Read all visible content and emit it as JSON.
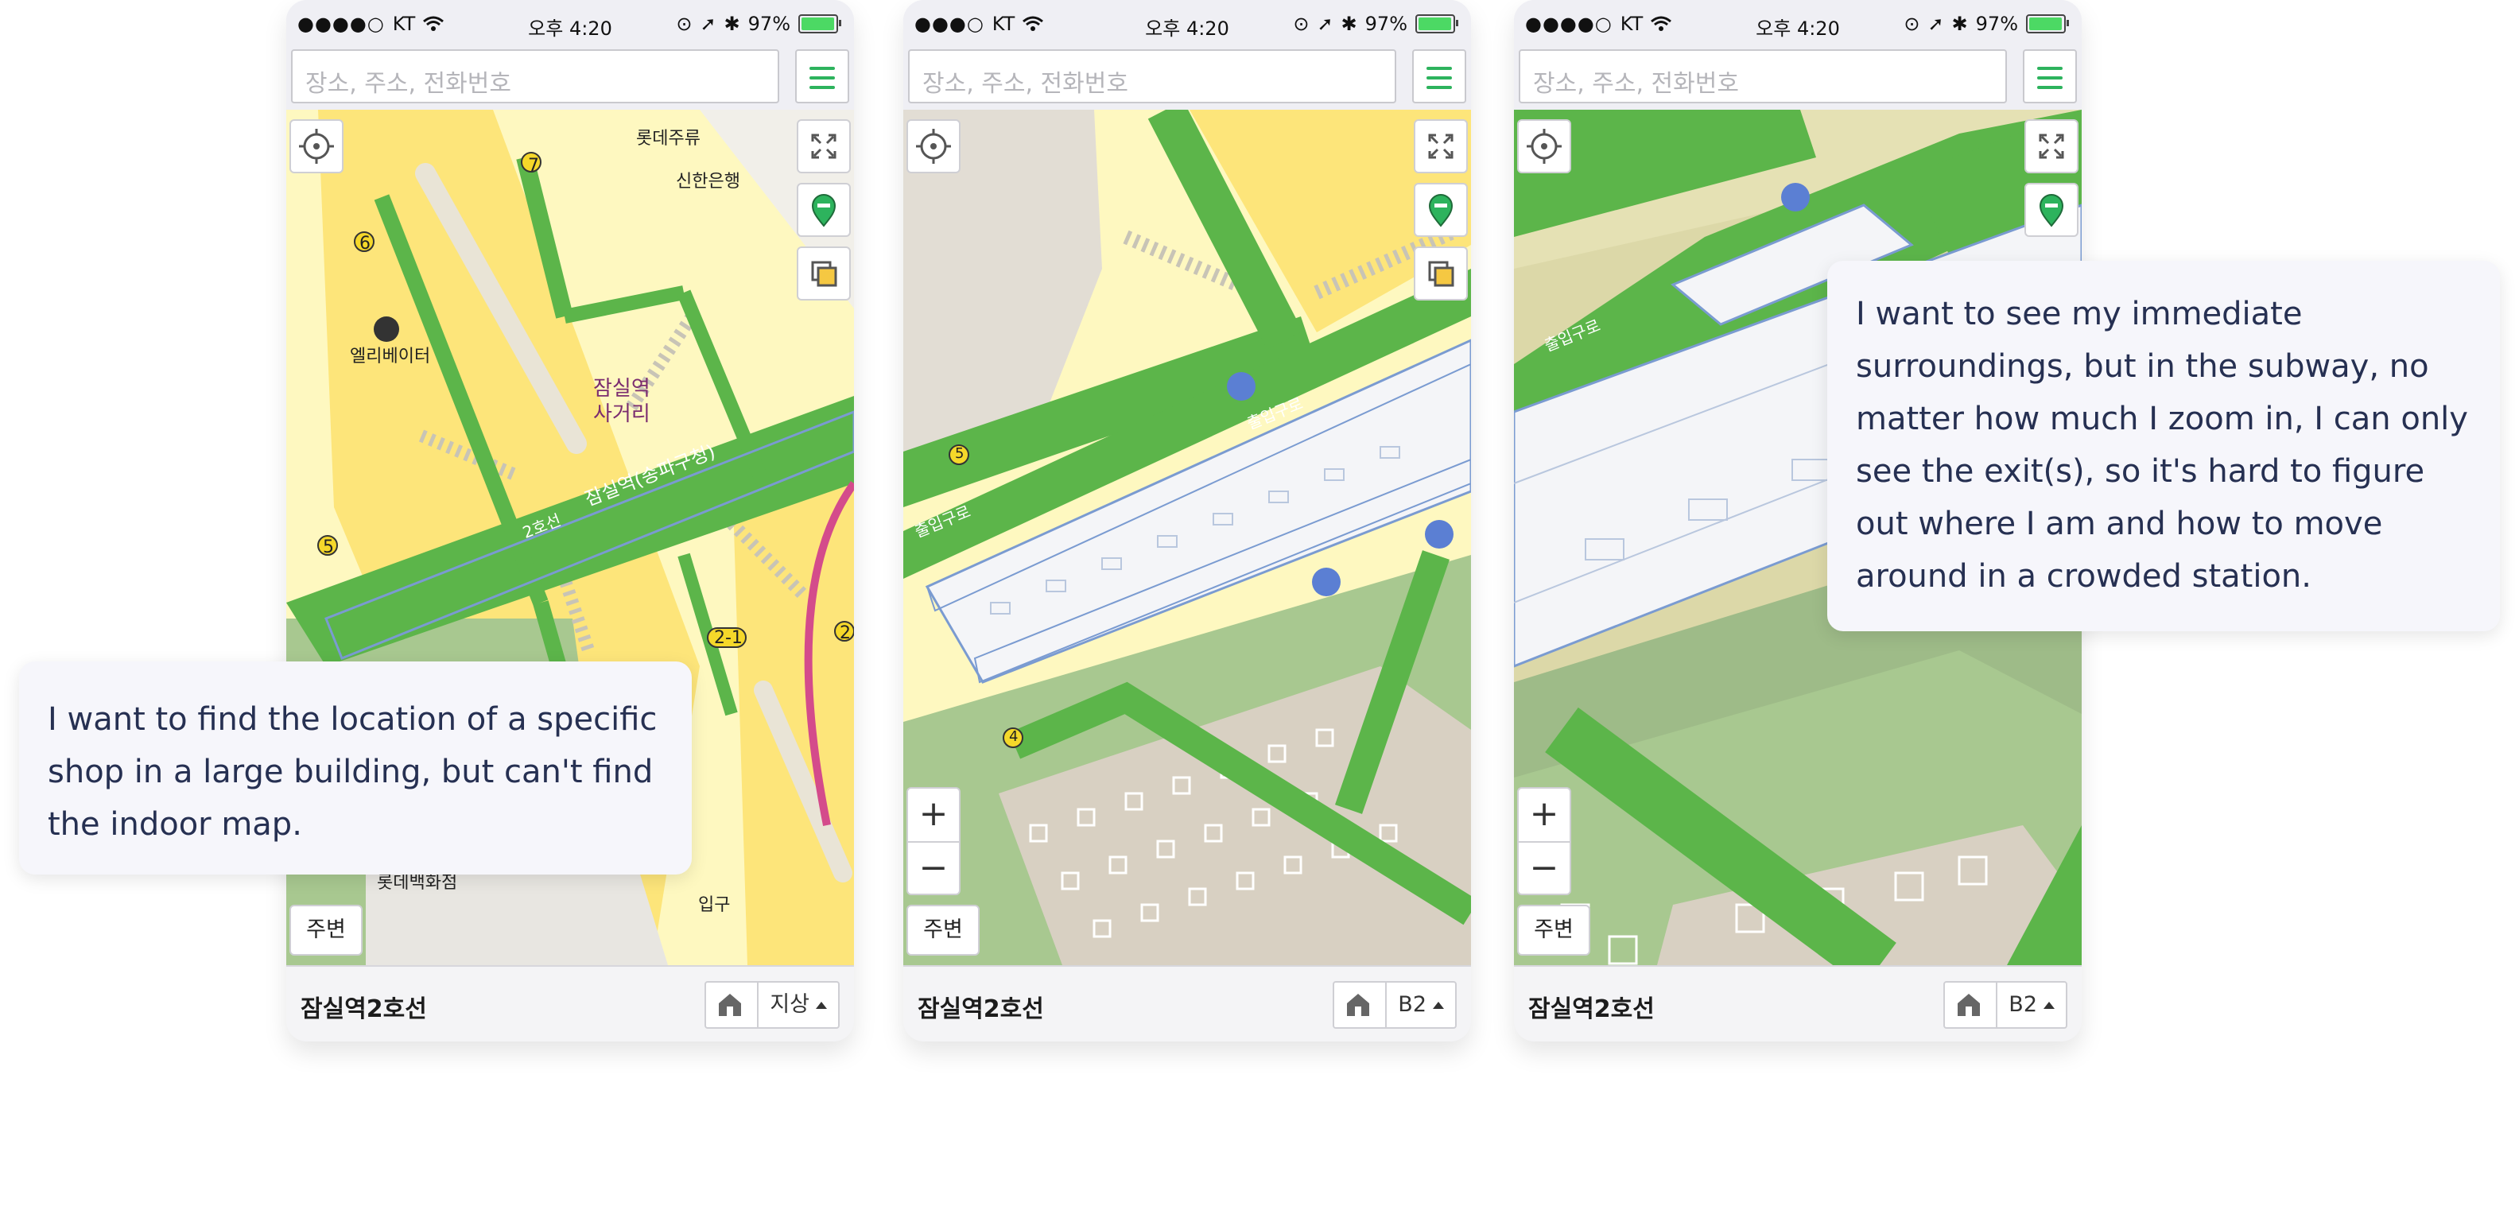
{
  "status_bar": {
    "carrier": "KT",
    "time": "오후 4:20",
    "battery_percent": "97%",
    "battery_level": 0.97
  },
  "search": {
    "placeholder": "장소, 주소, 전화번호"
  },
  "controls": {
    "nearby_label": "주변",
    "zoom_in": "+",
    "zoom_out": "−"
  },
  "colors": {
    "accent": "#2db35d",
    "walkway_green": "#5cb54a",
    "road_yellow": "#fde57a",
    "light_yellow": "#fef8c0",
    "station_blue": "#7a9bd1",
    "park_green": "#a8c890",
    "bubble_text": "#263052"
  },
  "screens": [
    {
      "station": "잠실역2호선",
      "floor": "지상",
      "map_labels": {
        "place1": "롯데주류",
        "place2": "신한은행",
        "place3": "엘리베이터",
        "intersection_1": "잠실역",
        "intersection_2": "사거리",
        "station_label": "잠실역(송파구청)",
        "line_label": "2호선",
        "dept_store": "롯데백화점",
        "entrance": "입구",
        "exit_5": "5",
        "exit_6": "6",
        "exit_7": "7",
        "exit_2_1": "2-1",
        "exit_2": "2"
      }
    },
    {
      "station": "잠실역2호선",
      "floor": "B2",
      "map_labels": {
        "exit_5": "5",
        "exit_4": "4",
        "passage_1": "출입구로",
        "passage_2": "출입구로"
      }
    },
    {
      "station": "잠실역2호선",
      "floor": "B2",
      "map_labels": {
        "passage_1": "출입구로"
      }
    }
  ],
  "callouts": [
    {
      "text": "I want to find the location of a specific shop in a large building, but can't find the indoor map."
    },
    {
      "text": "I want to see my immediate surroundings, but in the subway, no matter how much I zoom in, I can only see the exit(s), so it's hard to figure out where I am and how to move around in a crowded station."
    }
  ],
  "icons": [
    "signal-dots-icon",
    "wifi-icon",
    "location-arrow-icon",
    "bluetooth-icon",
    "battery-icon",
    "menu-icon",
    "locate-me-icon",
    "fullscreen-icon",
    "map-pin-icon",
    "layers-icon",
    "indoor-map-icon",
    "escalator-icon"
  ]
}
